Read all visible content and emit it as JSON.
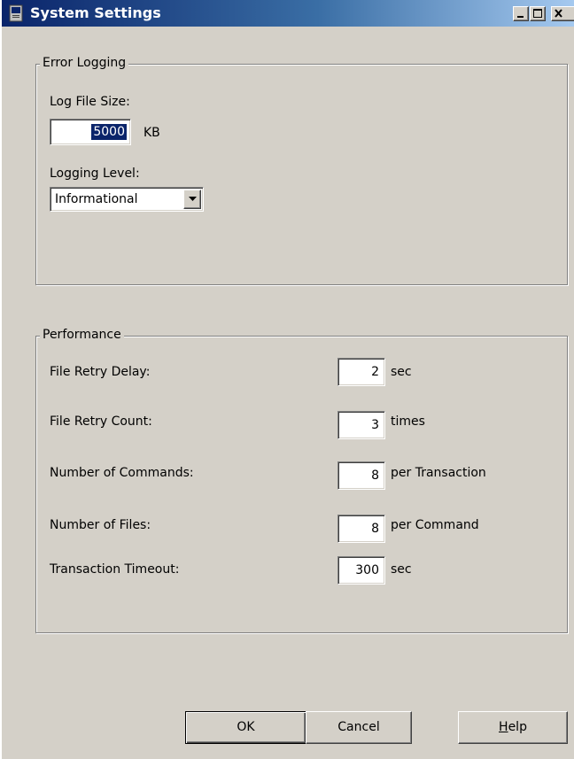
{
  "window": {
    "title": "System Settings",
    "icon": "monitor-icon",
    "controls": [
      "minimize-icon",
      "maximize-icon",
      "close-icon"
    ]
  },
  "error_logging": {
    "legend": "Error Logging",
    "log_file_size_label": "Log File Size:",
    "log_file_size_value": "5000",
    "log_file_size_unit": "KB",
    "logging_level_label": "Logging Level:",
    "logging_level_value": "Informational"
  },
  "performance": {
    "legend": "Performance",
    "rows": [
      {
        "label": "File Retry Delay:",
        "value": "2",
        "unit": "sec"
      },
      {
        "label": "File Retry Count:",
        "value": "3",
        "unit": "times"
      },
      {
        "label": "Number of Commands:",
        "value": "8",
        "unit": "per Transaction"
      },
      {
        "label": "Number of Files:",
        "value": "8",
        "unit": "per Command"
      },
      {
        "label": "Transaction Timeout:",
        "value": "300",
        "unit": "sec"
      }
    ]
  },
  "buttons": {
    "ok": "OK",
    "cancel": "Cancel",
    "help_accel": "H",
    "help_rest": "elp"
  }
}
